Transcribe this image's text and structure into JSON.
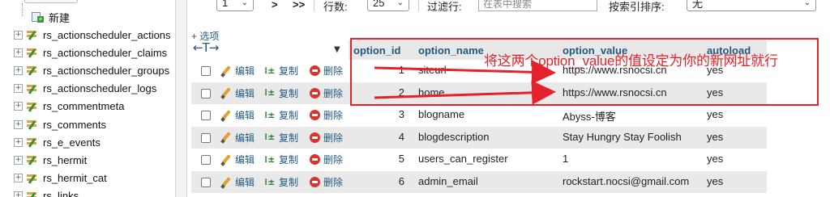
{
  "sidebar": {
    "new_label": "新建",
    "tables": [
      "rs_actionscheduler_actions",
      "rs_actionscheduler_claims",
      "rs_actionscheduler_groups",
      "rs_actionscheduler_logs",
      "rs_commentmeta",
      "rs_comments",
      "rs_e_events",
      "rs_hermit",
      "rs_hermit_cat",
      "rs_links"
    ]
  },
  "topbar": {
    "page_value": "1",
    "next_label": ">",
    "last_label": ">>",
    "rows_label": "行数:",
    "rows_value": "25",
    "filter_label": "过滤行:",
    "filter_placeholder": "在表中搜索",
    "sort_label": "按索引排序:",
    "sort_value": "无"
  },
  "options_link": "+ 选项",
  "columns": {
    "option_id": "option_id",
    "option_name": "option_name",
    "option_value": "option_value",
    "autoload": "autoload"
  },
  "actions": {
    "edit": "编辑",
    "copy": "复制",
    "delete": "删除"
  },
  "rows": [
    {
      "option_id": "1",
      "option_name": "siteurl",
      "option_value": "https://www.rsnocsi.cn",
      "autoload": "yes"
    },
    {
      "option_id": "2",
      "option_name": "home",
      "option_value": "https://www.rsnocsi.cn",
      "autoload": "yes"
    },
    {
      "option_id": "3",
      "option_name": "blogname",
      "option_value": "Abyss-博客",
      "autoload": "yes"
    },
    {
      "option_id": "4",
      "option_name": "blogdescription",
      "option_value": "Stay Hungry Stay Foolish",
      "autoload": "yes"
    },
    {
      "option_id": "5",
      "option_name": "users_can_register",
      "option_value": "1",
      "autoload": "yes"
    },
    {
      "option_id": "6",
      "option_name": "admin_email",
      "option_value": "rockstart.nocsi@gmail.com",
      "autoload": "yes"
    }
  ],
  "annotation": {
    "text": "将这两个option_value的值设定为你的新网址就行",
    "color": "#e5222b"
  },
  "colors": {
    "link": "#235a81",
    "row_even": "#e9e9e9",
    "annotation": "#e5222b"
  },
  "icons": {
    "expander": "plus-box-icon",
    "table": "table-edit-icon",
    "edit": "pencil-icon",
    "copy": "copy-icon",
    "delete": "delete-icon"
  }
}
